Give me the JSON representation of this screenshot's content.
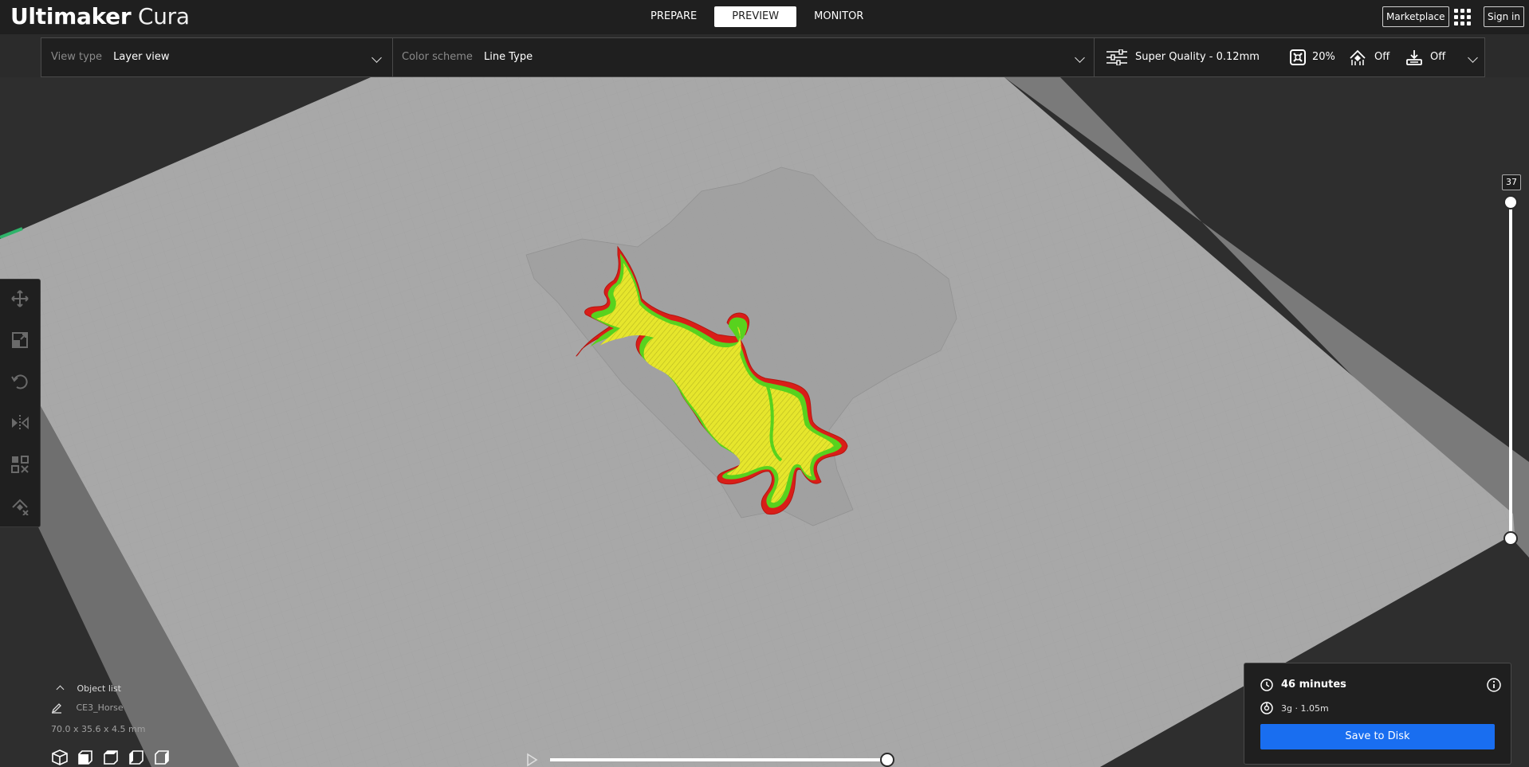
{
  "header": {
    "logo_bold": "Ultimaker",
    "logo_light": "Cura",
    "tabs": [
      {
        "label": "PREPARE"
      },
      {
        "label": "PREVIEW"
      },
      {
        "label": "MONITOR"
      }
    ],
    "active_tab": "PREVIEW",
    "marketplace_label": "Marketplace",
    "apps_icon": "apps-grid-icon",
    "signin_label": "Sign in"
  },
  "view_bar": {
    "view_type_label": "View type",
    "view_type_value": "Layer view",
    "color_scheme_label": "Color scheme",
    "color_scheme_value": "Line Type"
  },
  "print_settings": {
    "profile": "Super Quality - 0.12mm",
    "infill": "20%",
    "support": "Off",
    "adhesion": "Off"
  },
  "layer_slider": {
    "current_layer": "37"
  },
  "tools": [
    {
      "name": "move-icon"
    },
    {
      "name": "scale-icon"
    },
    {
      "name": "rotate-icon"
    },
    {
      "name": "mirror-icon"
    },
    {
      "name": "per-model-settings-icon"
    },
    {
      "name": "support-blocker-icon"
    }
  ],
  "object_list": {
    "label": "Object list",
    "object_name": "CE3_Horse",
    "dimensions": "70.0 x 35.6 x 4.5 mm"
  },
  "print_summary": {
    "time": "46 minutes",
    "material": "3g · 1.05m",
    "save_label": "Save to Disk"
  },
  "colors": {
    "accent": "#196ef0",
    "wall_outer": "#e8261e",
    "wall_inner": "#58d21e",
    "infill": "#e6e62c",
    "buildplate": "#a8a8a8"
  }
}
